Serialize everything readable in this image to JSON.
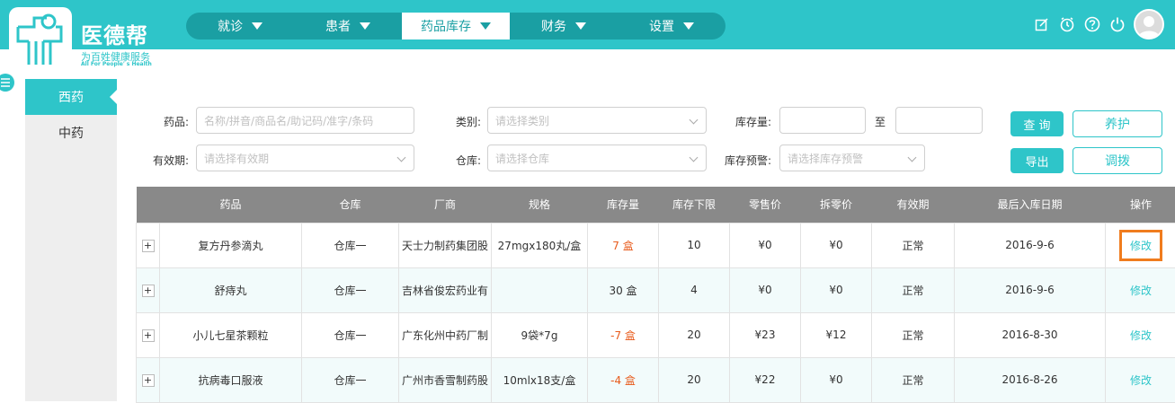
{
  "brand": {
    "name": "医德帮",
    "slogan": "为百姓健康服务",
    "slogan_en": "All For People' s Health"
  },
  "nav": {
    "items": [
      {
        "label": "就诊"
      },
      {
        "label": "患者"
      },
      {
        "label": "药品库存"
      },
      {
        "label": "财务"
      },
      {
        "label": "设置"
      }
    ],
    "active_index": 2
  },
  "header_icons": [
    "edit-icon",
    "timer-icon",
    "help-icon",
    "power-icon",
    "avatar"
  ],
  "sidebar": {
    "items": [
      {
        "label": "西药"
      },
      {
        "label": "中药"
      }
    ],
    "active_index": 0
  },
  "filters": {
    "drug": {
      "label": "药品:",
      "placeholder": "名称/拼音/商品名/助记码/准字/条码"
    },
    "category": {
      "label": "类别:",
      "placeholder": "请选择类别"
    },
    "stock": {
      "label": "库存量:",
      "to": "至"
    },
    "expiry": {
      "label": "有效期:",
      "placeholder": "请选择有效期"
    },
    "warehouse": {
      "label": "仓库:",
      "placeholder": "请选择仓库"
    },
    "warning": {
      "label": "库存预警:",
      "placeholder": "请选择库存预警"
    }
  },
  "buttons": {
    "query": "查 询",
    "export": "导出",
    "maintain": "养护",
    "transfer": "调拨"
  },
  "table": {
    "headers": [
      "",
      "药品",
      "仓库",
      "厂商",
      "规格",
      "库存量",
      "库存下限",
      "零售价",
      "拆零价",
      "有效期",
      "最后入库日期",
      "操作"
    ],
    "rows": [
      {
        "expand": "+",
        "drug": "复方丹参滴丸",
        "warehouse": "仓库一",
        "maker": "天士力制药集团股",
        "spec": "27mgx180丸/盒",
        "stock": "7 盒",
        "stock_low": true,
        "min": "10",
        "retail": "¥0",
        "split": "¥0",
        "expiry": "正常",
        "last_in": "2016-9-6",
        "action": "修改"
      },
      {
        "expand": "+",
        "drug": "舒痔丸",
        "warehouse": "仓库一",
        "maker": "吉林省俊宏药业有",
        "spec": "",
        "stock": "30 盒",
        "stock_low": false,
        "min": "4",
        "retail": "¥0",
        "split": "¥0",
        "expiry": "正常",
        "last_in": "2016-9-6",
        "action": "修改"
      },
      {
        "expand": "+",
        "drug": "小儿七星茶颗粒",
        "warehouse": "仓库一",
        "maker": "广东化州中药厂制",
        "spec": "9袋*7g",
        "stock": "-7 盒",
        "stock_low": true,
        "min": "20",
        "retail": "¥23",
        "split": "¥12",
        "expiry": "正常",
        "last_in": "2016-8-30",
        "action": "修改"
      },
      {
        "expand": "+",
        "drug": "抗病毒口服液",
        "warehouse": "仓库一",
        "maker": "广州市香雪制药股",
        "spec": "10mlx18支/盒",
        "stock": "-4 盒",
        "stock_low": true,
        "min": "20",
        "retail": "¥22",
        "split": "¥0",
        "expiry": "正常",
        "last_in": "2016-8-26",
        "action": "修改"
      }
    ]
  }
}
